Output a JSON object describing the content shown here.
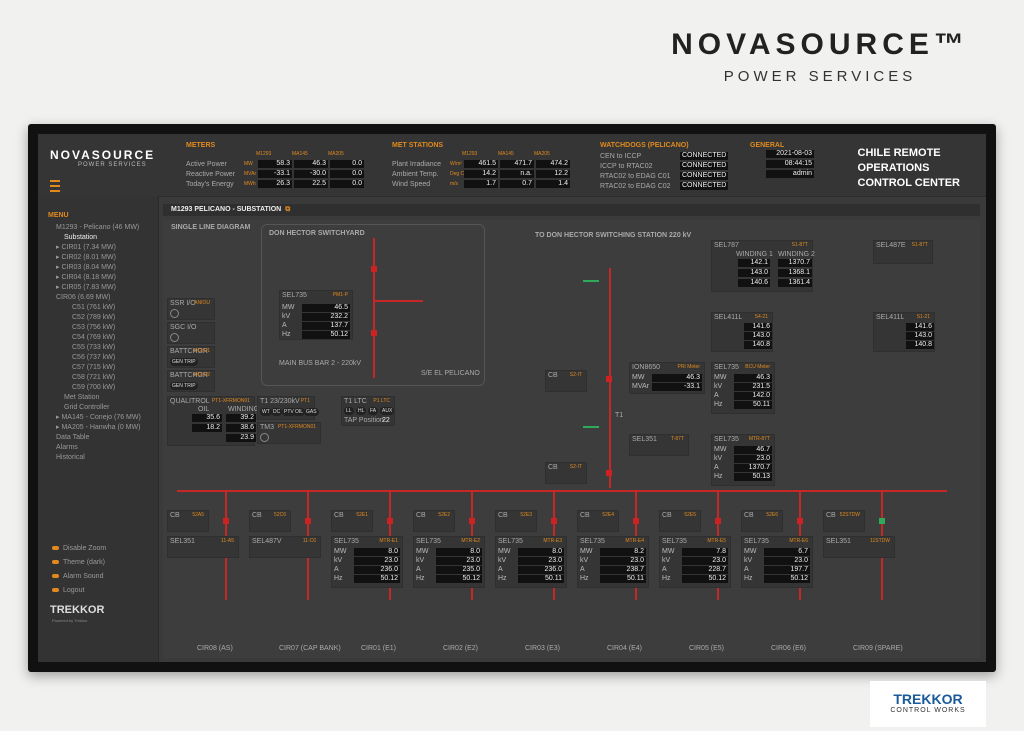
{
  "brand": {
    "name": "NOVASOURCE™",
    "sub": "POWER SERVICES"
  },
  "app": {
    "logo": "NOVASOURCE",
    "logo_sub": "POWER SERVICES",
    "title1": "CHILE REMOTE",
    "title2": "OPERATIONS",
    "title3": "CONTROL CENTER"
  },
  "meters": {
    "title": "METERS",
    "cols": [
      "M1293",
      "MA145",
      "MA205"
    ],
    "rows": [
      {
        "label": "Active Power",
        "unit": "MW",
        "v": [
          "58.3",
          "46.3",
          "0.0"
        ]
      },
      {
        "label": "Reactive Power",
        "unit": "MVAr",
        "v": [
          "-33.1",
          "-30.0",
          "0.0"
        ]
      },
      {
        "label": "Today's Energy",
        "unit": "MWh",
        "v": [
          "26.3",
          "22.5",
          "0.0"
        ]
      }
    ]
  },
  "met": {
    "title": "MET STATIONS",
    "cols": [
      "M1293",
      "MA145",
      "MA205"
    ],
    "rows": [
      {
        "label": "Plant Irradiance",
        "unit": "W/m²",
        "v": [
          "461.5",
          "471.7",
          "474.2"
        ]
      },
      {
        "label": "Ambient Temp.",
        "unit": "Deg C",
        "v": [
          "14.2",
          "n.a.",
          "12.2"
        ]
      },
      {
        "label": "Wind Speed",
        "unit": "m/s",
        "v": [
          "1.7",
          "0.7",
          "1.4"
        ]
      }
    ]
  },
  "wd": {
    "title": "WATCHDOGS (PELICANO)",
    "rows": [
      {
        "label": "CEN to ICCP",
        "v": "CONNECTED"
      },
      {
        "label": "ICCP to RTAC02",
        "v": "CONNECTED"
      },
      {
        "label": "RTAC02 to EDAG C01",
        "v": "CONNECTED"
      },
      {
        "label": "RTAC02 to EDAG C02",
        "v": "CONNECTED"
      }
    ]
  },
  "general": {
    "title": "GENERAL",
    "date": "2021-08-03",
    "time": "08:44:15",
    "user": "admin"
  },
  "menu": {
    "title": "MENU",
    "items": [
      "M1293 - Pelicano (46 MW)",
      "Substation",
      "▸ CIR01 (7.34 MW)",
      "▸ CIR02 (8.01 MW)",
      "▸ CIR03 (8.04 MW)",
      "▸ CIR04 (8.18 MW)",
      "▸ CIR05 (7.83 MW)",
      "CIR06 (6.69 MW)",
      "C51 (761 kW)",
      "C52 (789 kW)",
      "C53 (756 kW)",
      "C54 (769 kW)",
      "C55 (733 kW)",
      "C56 (737 kW)",
      "C57 (715 kW)",
      "C58 (721 kW)",
      "C59 (700 kW)",
      "Met Station",
      "Grid Controller",
      "▸ MA145 - Conejo (76 MW)",
      "▸ MA205 - Hanwha (0 MW)",
      "Data Table",
      "Alarms",
      "Historical"
    ],
    "bottom": [
      "Disable Zoom",
      "Theme (dark)",
      "Alarm Sound",
      "Logout"
    ],
    "brand": "TREKKOR",
    "brand_sub": "Powered by Trekkor"
  },
  "page": {
    "title": "M1293 PELICANO - SUBSTATION",
    "sld": "SINGLE LINE DIAGRAM",
    "swyard": "DON HECTOR SWITCHYARD",
    "to": "TO DON HECTOR SWITCHING STATION 220 kV",
    "bus": "MAIN BUS BAR 2 - 220kV",
    "se": "S/E EL PELICANO",
    "t1": "T1"
  },
  "left_boxes": [
    {
      "name": "SSR I/O",
      "tag": "ANIOU"
    },
    {
      "name": "SGC I/O",
      "tag": ""
    },
    {
      "name": "BATTCHGR",
      "tag": "BCH01",
      "btn": "GEN TRIP"
    },
    {
      "name": "BATTCHGR",
      "tag": "BCH02",
      "btn": "GEN TRIP"
    }
  ],
  "qualitrol": {
    "name": "QUALITROL",
    "tag": "PT1-XFRMON01",
    "oil": "OIL",
    "winding": "WINDING",
    "v": [
      "35.6",
      "18.2",
      "39.2",
      "38.6",
      "23.9"
    ]
  },
  "t1box": {
    "name": "T1 23/230kV",
    "tag": "PT1",
    "btns": [
      "WT",
      "DC",
      "PTV",
      "OIL",
      "GAS"
    ]
  },
  "tm3": {
    "name": "TM3",
    "tag": "PT1-XFRMON01"
  },
  "ltc": {
    "name": "T1 LTC",
    "tag": "P1 LTC",
    "btns": [
      "LL",
      "HL",
      "FA",
      "AUX"
    ],
    "tap": "TAP Position",
    "tap_v": "22"
  },
  "sel735_top": {
    "name": "SEL735",
    "tag": "PM1-P",
    "keys": [
      "MW",
      "kV",
      "A",
      "Hz"
    ],
    "v": [
      "46.5",
      "232.2",
      "137.7",
      "50.12"
    ]
  },
  "sel787": {
    "name": "SEL787",
    "tag": "S1-87T",
    "w1": "WINDING 1",
    "w2": "WINDING 2",
    "keys": [
      "A",
      "A",
      "A"
    ],
    "a": [
      "142.1",
      "143.0",
      "140.6"
    ],
    "b": [
      "1370.7",
      "1368.1",
      "1361.4"
    ]
  },
  "sel487e": {
    "name": "SEL487E",
    "tag": "S1-87T"
  },
  "sel411l_a": {
    "name": "SEL411L",
    "tag": "S4-21",
    "v": [
      "141.6",
      "143.0",
      "140.8"
    ]
  },
  "sel411l_b": {
    "name": "SEL411L",
    "tag": "S1-21",
    "v": [
      "141.6",
      "143.0",
      "140.8"
    ]
  },
  "ion": {
    "name": "ION8650",
    "tag": "PRI Meter",
    "keys": [
      "MW",
      "MVAr"
    ],
    "v": [
      "46.3",
      "-33.1"
    ]
  },
  "sel735_b": {
    "name": "SEL735",
    "tag": "BCU Meter",
    "keys": [
      "MW",
      "kV",
      "A",
      "Hz"
    ],
    "v": [
      "46.3",
      "231.5",
      "142.0",
      "50.11"
    ]
  },
  "sel351_t": {
    "name": "SEL351",
    "tag": "T-87T"
  },
  "sel735_c": {
    "name": "SEL735",
    "tag": "MTR-87T",
    "keys": [
      "MW",
      "kV",
      "A",
      "Hz"
    ],
    "v": [
      "46.7",
      "23.0",
      "1370.7",
      "50.13"
    ]
  },
  "cbs": [
    {
      "name": "CB",
      "tag": "S2-IT"
    },
    {
      "name": "CB",
      "tag": "S2-IT"
    }
  ],
  "feeders": [
    {
      "label": "CIR08 (AS)",
      "cb": "52A5",
      "relay": "SEL351",
      "rtag": "11-A5"
    },
    {
      "label": "CIR07 (CAP BANK)",
      "cb": "52C6",
      "relay": "SEL487V",
      "rtag": "11-C6"
    },
    {
      "label": "CIR01 (E1)",
      "cb": "52E1",
      "relay": "SEL735",
      "rtag": "MTR-E1",
      "v": [
        "8.0",
        "23.0",
        "236.0",
        "50.12"
      ]
    },
    {
      "label": "CIR02 (E2)",
      "cb": "52E2",
      "relay": "SEL735",
      "rtag": "MTR-E2",
      "v": [
        "8.0",
        "23.0",
        "235.0",
        "50.12"
      ]
    },
    {
      "label": "CIR03 (E3)",
      "cb": "52E3",
      "relay": "SEL735",
      "rtag": "MTR-E3",
      "v": [
        "8.0",
        "23.0",
        "236.0",
        "50.11"
      ]
    },
    {
      "label": "CIR04 (E4)",
      "cb": "52E4",
      "relay": "SEL735",
      "rtag": "MTR-E4",
      "v": [
        "8.2",
        "23.0",
        "238.7",
        "50.11"
      ]
    },
    {
      "label": "CIR05 (E5)",
      "cb": "52E5",
      "relay": "SEL735",
      "rtag": "MTR-E5",
      "v": [
        "7.8",
        "23.0",
        "228.7",
        "50.12"
      ]
    },
    {
      "label": "CIR06 (E6)",
      "cb": "52E6",
      "relay": "SEL735",
      "rtag": "MTR-E6",
      "v": [
        "6.7",
        "23.0",
        "197.7",
        "50.12"
      ]
    },
    {
      "label": "CIR09 (SPARE)",
      "cb": "52STDW",
      "relay": "SEL351",
      "rtag": "11STDW"
    }
  ],
  "mkeys": [
    "MW",
    "kV",
    "A",
    "Hz"
  ],
  "footer": {
    "a": "TREKKOR",
    "b": "CONTROL WORKS"
  }
}
